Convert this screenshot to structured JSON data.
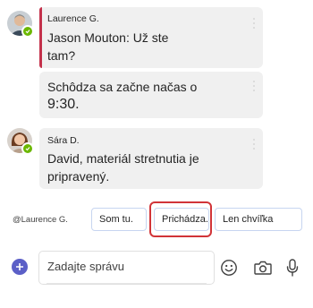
{
  "messages": [
    {
      "sender": "Laurence G.",
      "text_lines": [
        "Jason Mouton: Už ste",
        "tam?"
      ],
      "highlighted": true
    },
    {
      "sender": "",
      "text_lines": [
        "Schôdza sa začne načas o",
        "9:30."
      ],
      "highlighted": false
    },
    {
      "sender": "Sára D.",
      "text_lines": [
        "David, materiál stretnutia je",
        "pripravený."
      ],
      "highlighted": false
    }
  ],
  "suggestions": {
    "mention": "@Laurence G.",
    "chips": [
      "Som tu.",
      "Prichádza.",
      "Len chvíľka"
    ],
    "highlighted_chip": "Prichádza."
  },
  "composer": {
    "placeholder": "Zadajte správu"
  },
  "icons": {
    "add": "plus-circle-icon",
    "emoji": "emoji-icon",
    "camera": "camera-icon",
    "mic": "microphone-icon",
    "presence": "available-check-icon"
  },
  "colors": {
    "presence_available": "#6bb700",
    "brand": "#5b5fc7",
    "highlight_bar": "#c4314b",
    "highlight_outline": "#d13438"
  }
}
